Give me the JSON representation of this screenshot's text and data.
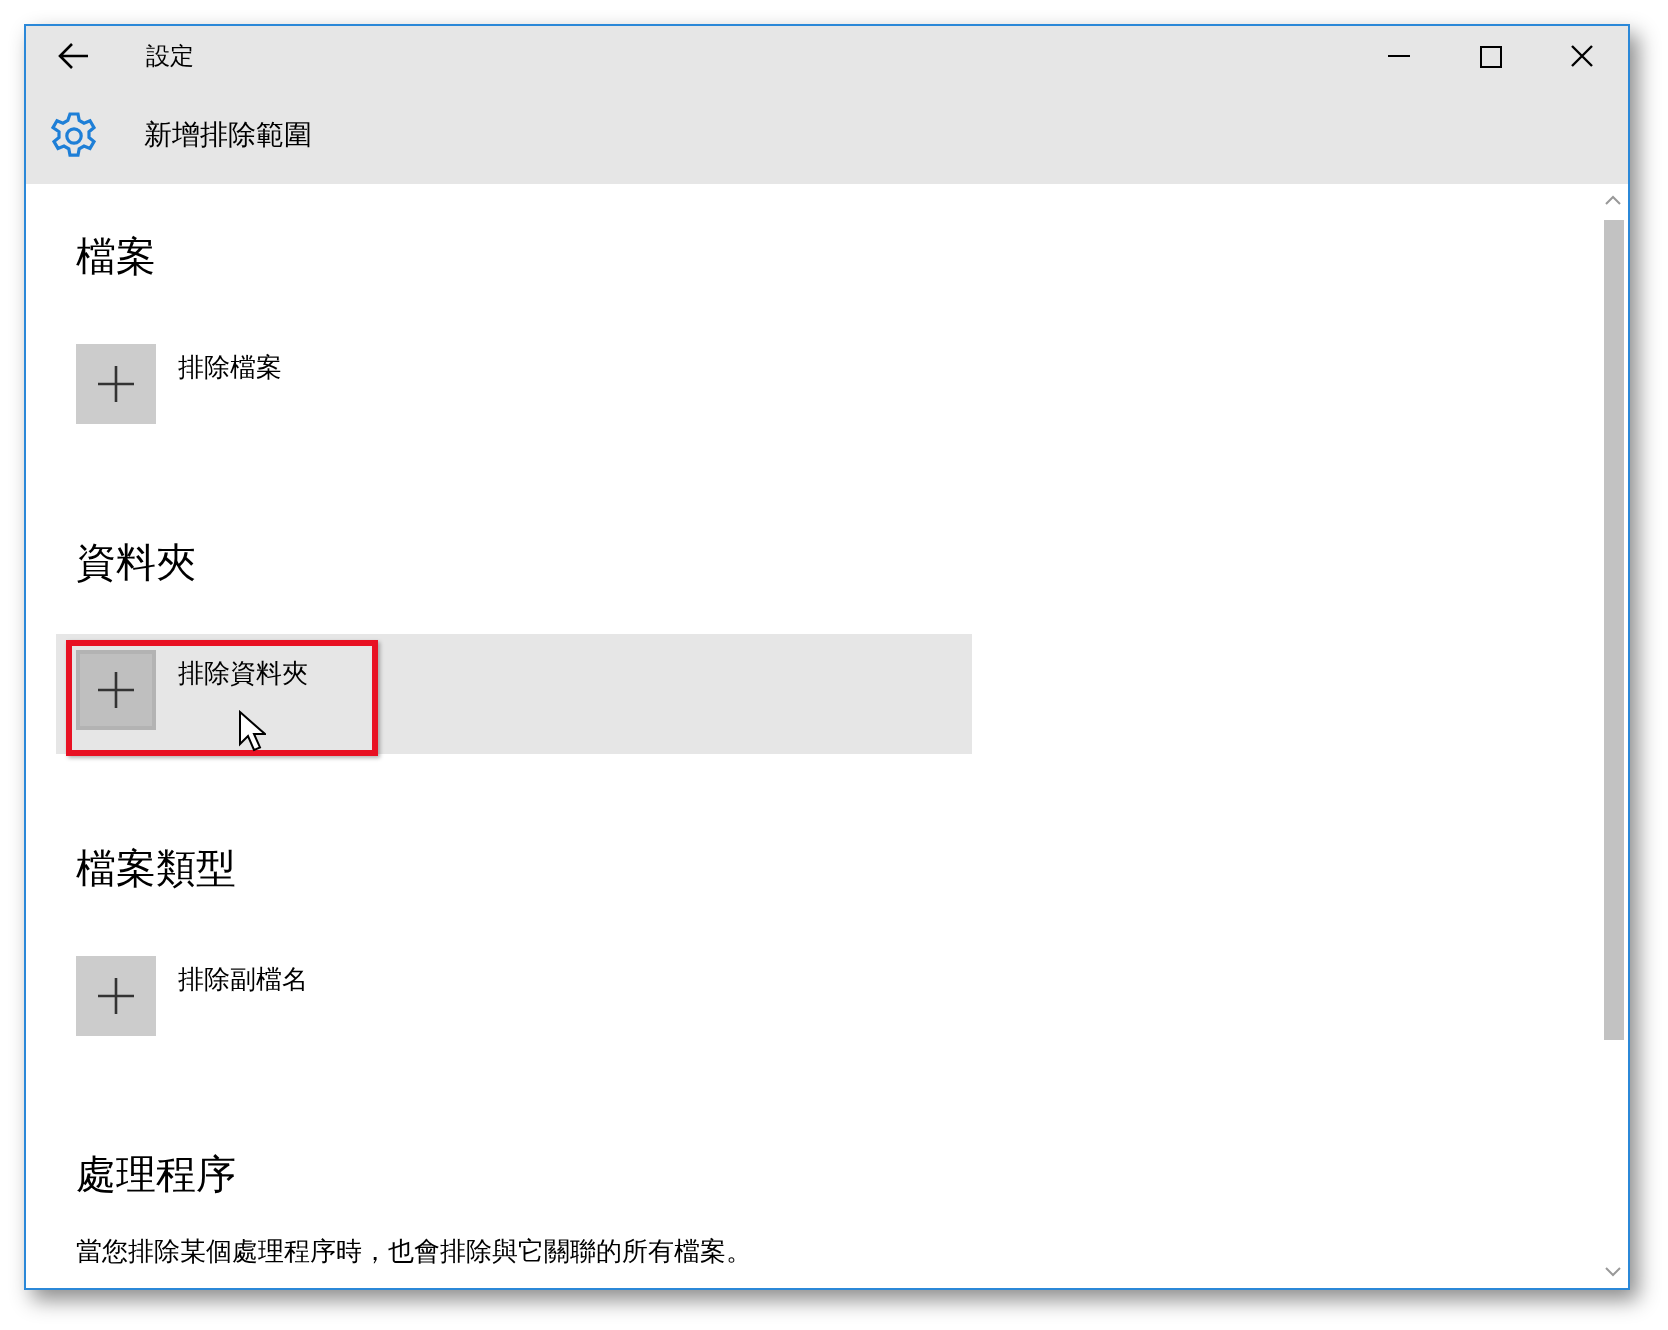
{
  "window": {
    "title": "設定"
  },
  "page_title": "新增排除範圍",
  "sections": [
    {
      "heading": "檔案",
      "items": [
        {
          "label": "排除檔案",
          "hovered": false,
          "highlighted": false
        }
      ]
    },
    {
      "heading": "資料夾",
      "items": [
        {
          "label": "排除資料夾",
          "hovered": true,
          "highlighted": true
        }
      ]
    },
    {
      "heading": "檔案類型",
      "items": [
        {
          "label": "排除副檔名",
          "hovered": false,
          "highlighted": false
        }
      ]
    },
    {
      "heading": "處理程序",
      "description": "當您排除某個處理程序時，也會排除與它關聯的所有檔案。"
    }
  ]
}
